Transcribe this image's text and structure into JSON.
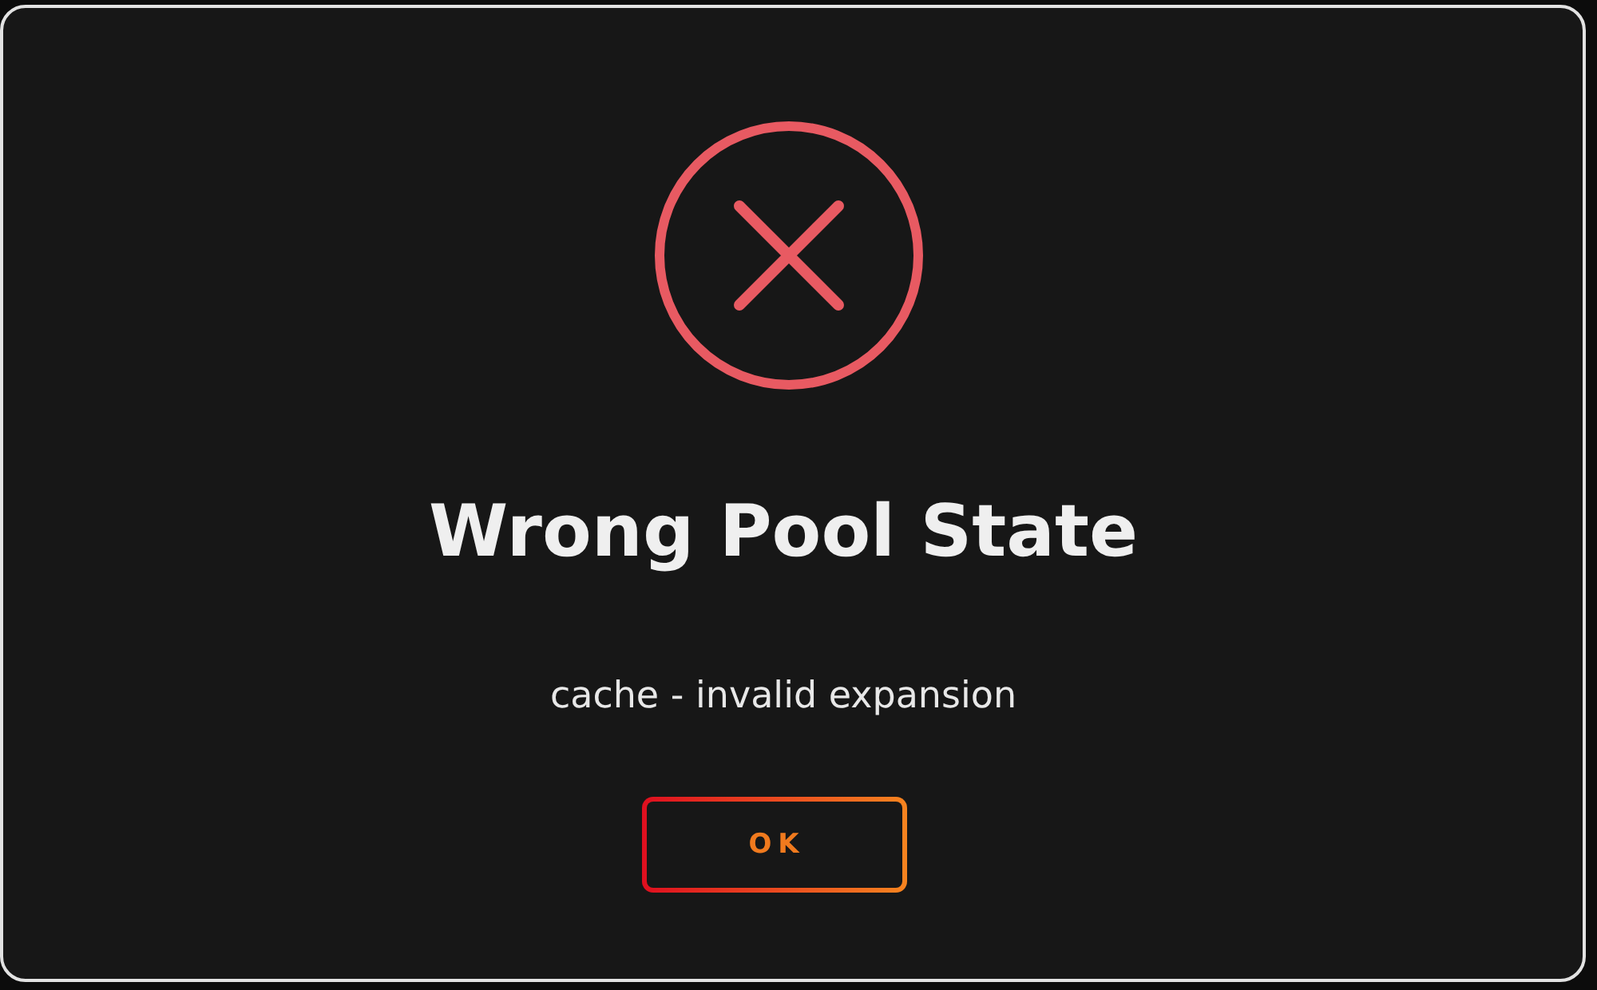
{
  "dialog": {
    "title": "Wrong Pool State",
    "message": "cache - invalid expansion",
    "buttons": [
      {
        "label": "OK"
      }
    ]
  }
}
